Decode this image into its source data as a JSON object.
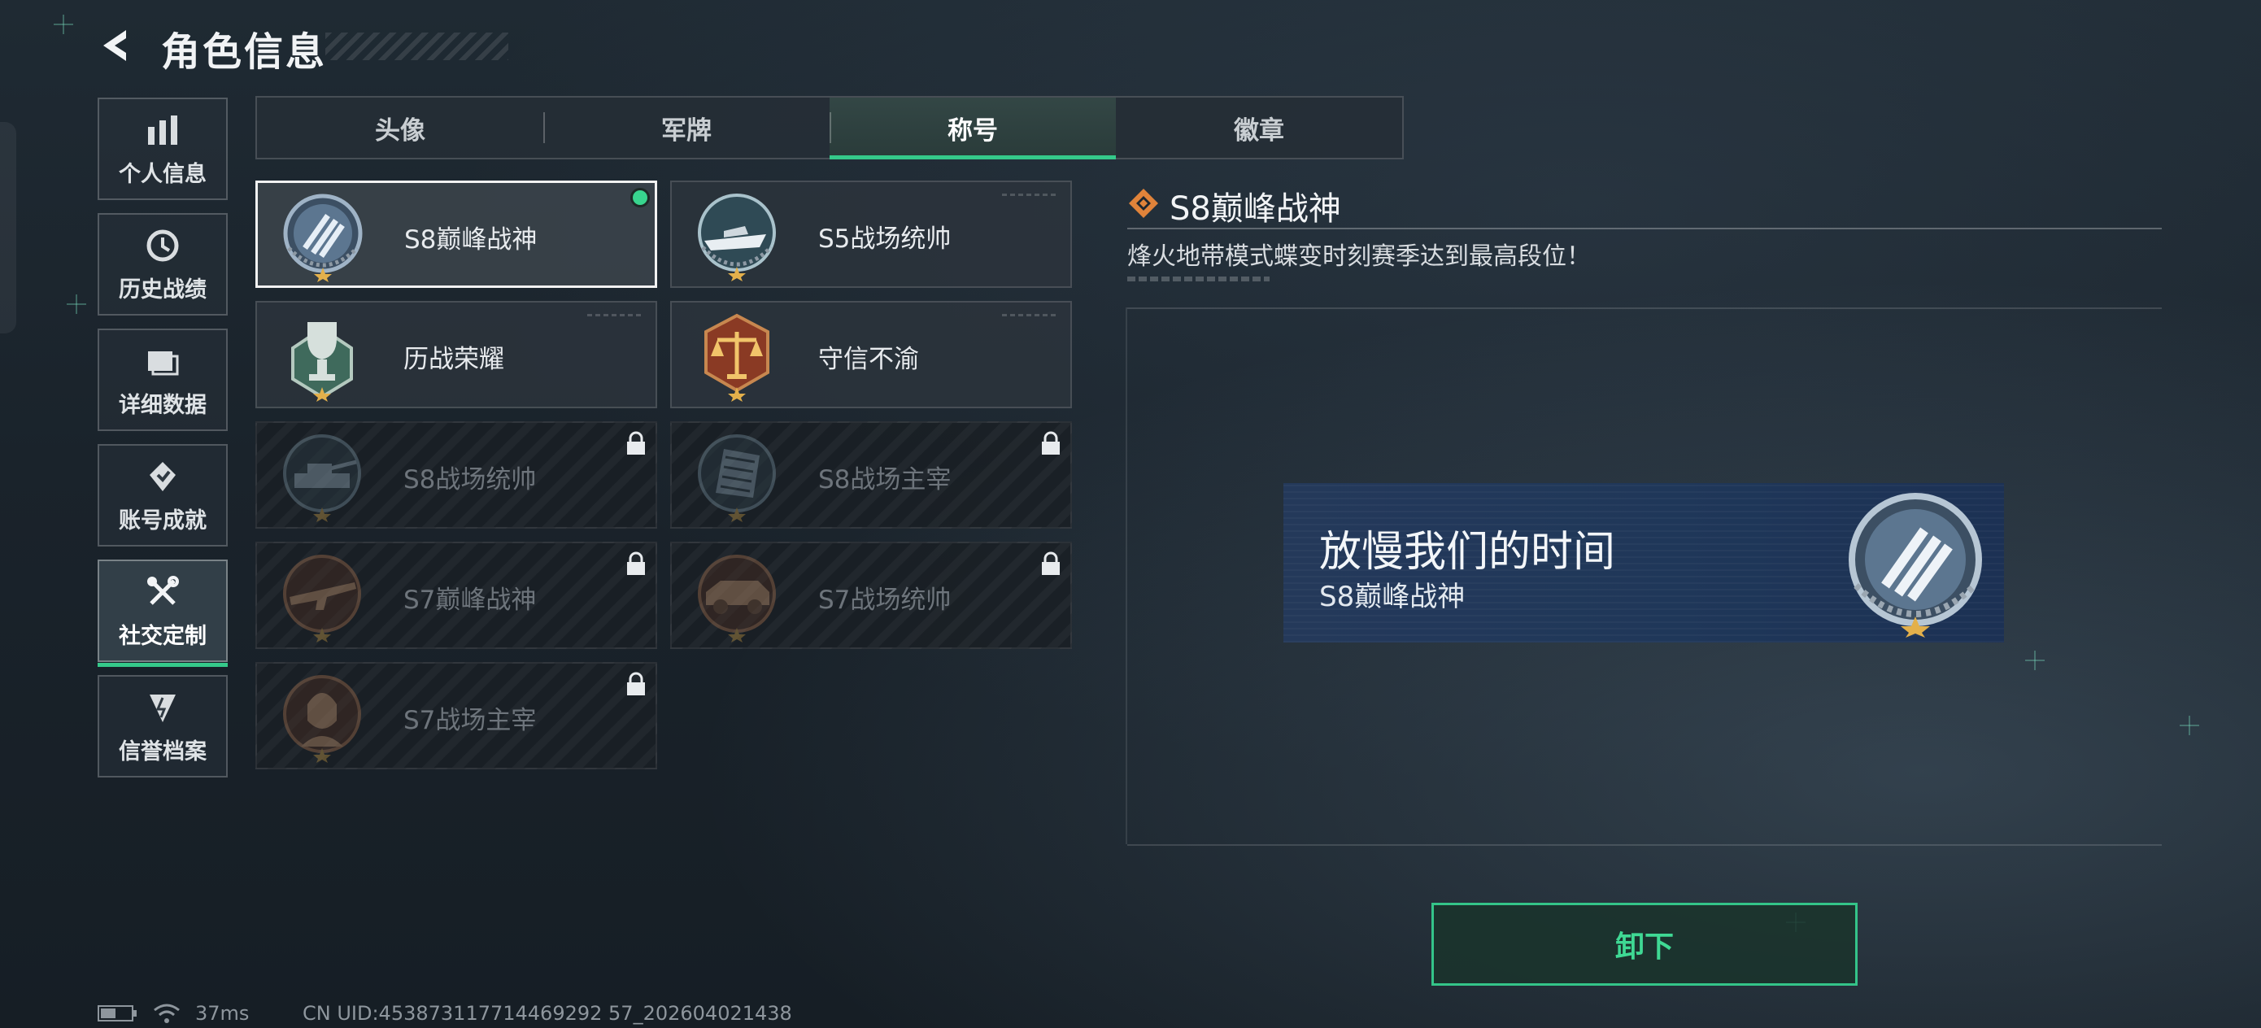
{
  "header": {
    "title": "角色信息"
  },
  "sidebar": {
    "items": [
      {
        "label": "个人信息",
        "icon": "bar-chart-icon"
      },
      {
        "label": "历史战绩",
        "icon": "history-icon"
      },
      {
        "label": "详细数据",
        "icon": "folder-icon"
      },
      {
        "label": "账号成就",
        "icon": "achievement-icon"
      },
      {
        "label": "社交定制",
        "icon": "tools-icon",
        "active": true
      },
      {
        "label": "信誉档案",
        "icon": "shield-icon"
      }
    ]
  },
  "tabs": [
    {
      "label": "头像"
    },
    {
      "label": "军牌"
    },
    {
      "label": "称号",
      "active": true
    },
    {
      "label": "徽章"
    }
  ],
  "titles": [
    {
      "name": "S8巅峰战神",
      "emblem": "stripes-medal-icon",
      "selected": true,
      "equipped": true,
      "locked": false
    },
    {
      "name": "S5战场统帅",
      "emblem": "boat-medal-icon",
      "locked": false
    },
    {
      "name": "历战荣耀",
      "emblem": "trophy-medal-icon",
      "locked": false
    },
    {
      "name": "守信不渝",
      "emblem": "scales-medal-icon",
      "locked": false
    },
    {
      "name": "S8战场统帅",
      "emblem": "tank-medal-icon",
      "locked": true
    },
    {
      "name": "S8战场主宰",
      "emblem": "building-medal-icon",
      "locked": true
    },
    {
      "name": "S7巅峰战神",
      "emblem": "rifle-medal-icon",
      "locked": true
    },
    {
      "name": "S7战场统帅",
      "emblem": "vehicle-medal-icon",
      "locked": true
    },
    {
      "name": "S7战场主宰",
      "emblem": "soldier-medal-icon",
      "locked": true
    }
  ],
  "detail": {
    "title": "S8巅峰战神",
    "description": "烽火地带模式蝶变时刻赛季达到最高段位！"
  },
  "preview": {
    "player_name": "放慢我们的时间",
    "title": "S8巅峰战神"
  },
  "action": {
    "unequip_label": "卸下"
  },
  "status": {
    "ping": "37ms",
    "uid": "CN UID:453873117714469292 57_202604021438"
  },
  "colors": {
    "accent": "#35c98a",
    "background": "#1b242c",
    "preview_bg": "#22385a",
    "title_icon": "#e0833a"
  }
}
